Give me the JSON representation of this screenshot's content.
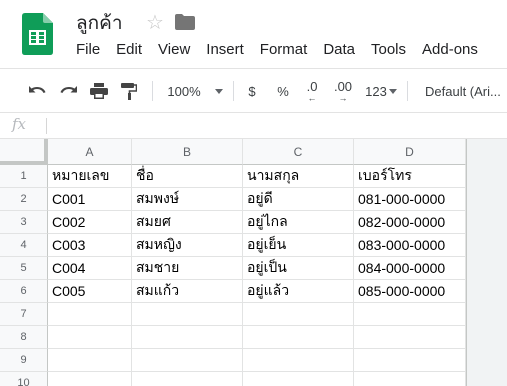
{
  "document": {
    "title": "ลูกค้า"
  },
  "menu": [
    "File",
    "Edit",
    "View",
    "Insert",
    "Format",
    "Data",
    "Tools",
    "Add-ons"
  ],
  "toolbar": {
    "zoom": "100%",
    "currency": "$",
    "percent": "%",
    "decrease_decimal": ".0",
    "increase_decimal": ".00",
    "more_formats": "123",
    "font": "Default (Ari..."
  },
  "formula_bar": {
    "label": "fx",
    "value": ""
  },
  "grid": {
    "columns": [
      "A",
      "B",
      "C",
      "D"
    ],
    "row_numbers": [
      "1",
      "2",
      "3",
      "4",
      "5",
      "6",
      "7",
      "8",
      "9",
      "10"
    ],
    "rows": [
      [
        "หมายเลข",
        "ชื่อ",
        "นามสกุล",
        "เบอร์โทร"
      ],
      [
        "C001",
        "สมพงษ์",
        "อยู่ดี",
        "081-000-0000"
      ],
      [
        "C002",
        "สมยศ",
        "อยู่ไกล",
        "082-000-0000"
      ],
      [
        "C003",
        "สมหญิง",
        "อยู่เย็น",
        "083-000-0000"
      ],
      [
        "C004",
        "สมชาย",
        "อยู่เป็น",
        "084-000-0000"
      ],
      [
        "C005",
        "สมแก้ว",
        "อยู่แล้ว",
        "085-000-0000"
      ],
      [
        "",
        "",
        "",
        ""
      ],
      [
        "",
        "",
        "",
        ""
      ],
      [
        "",
        "",
        "",
        ""
      ],
      [
        "",
        "",
        "",
        ""
      ]
    ]
  },
  "colors": {
    "sheets_green": "#0f9d58",
    "header_bg": "#f8f9fa",
    "gridline": "#e2e3e3"
  }
}
